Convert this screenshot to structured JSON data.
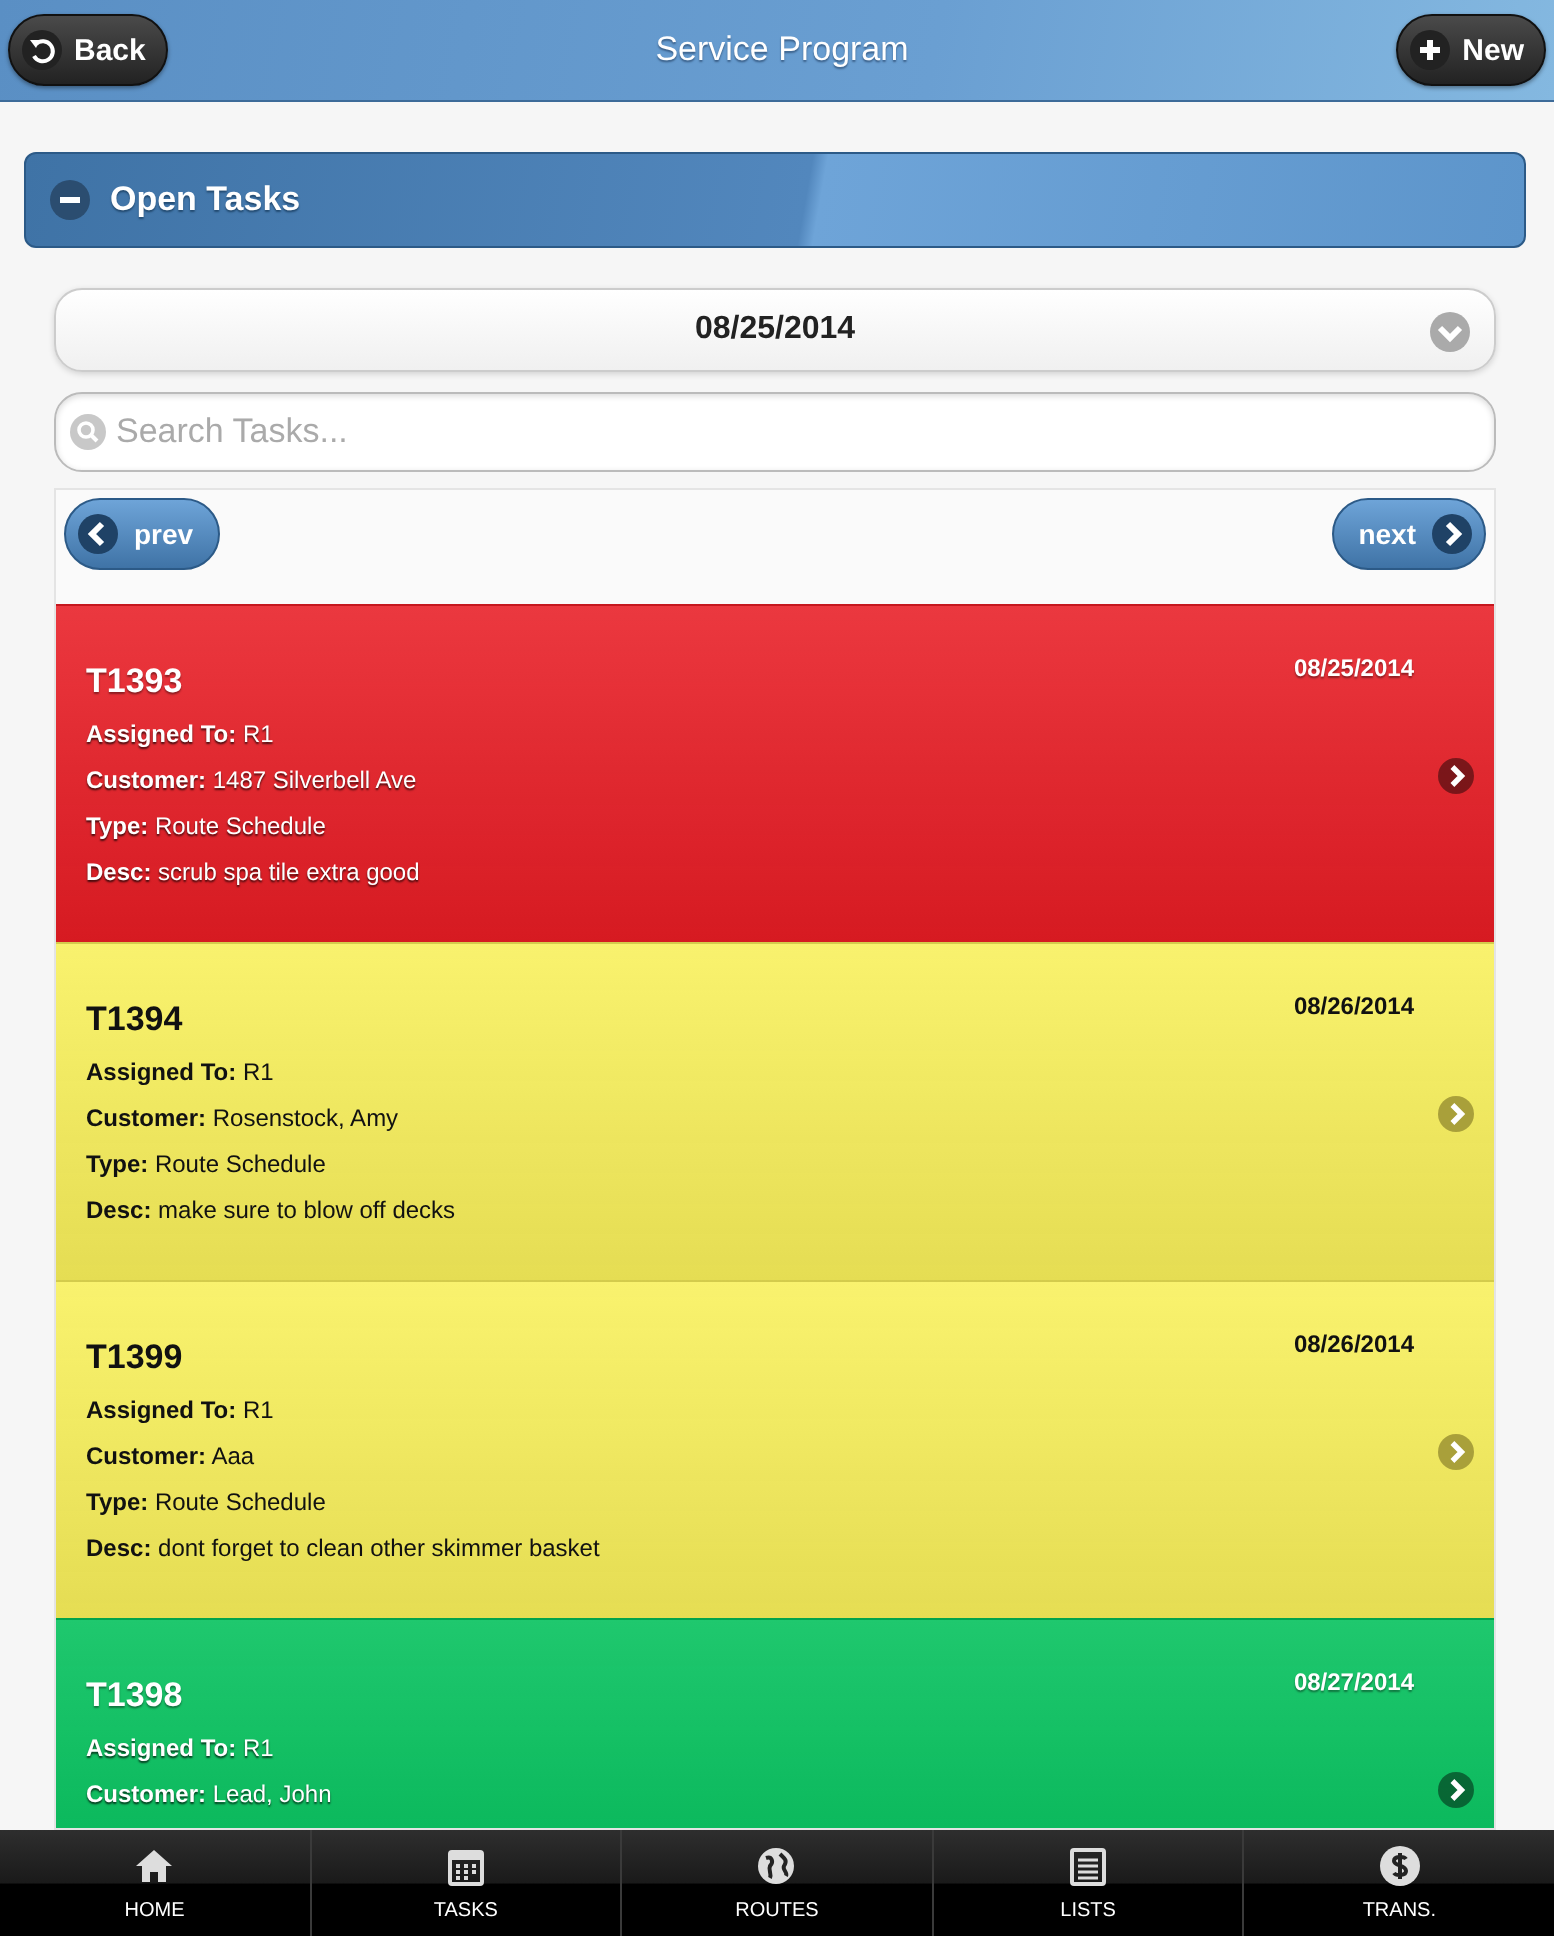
{
  "header": {
    "back": "Back",
    "title": "Service Program",
    "new": "New"
  },
  "section": {
    "title": "Open Tasks",
    "expanded": true
  },
  "date_select": {
    "value": "08/25/2014"
  },
  "search": {
    "placeholder": "Search Tasks..."
  },
  "pager": {
    "prev": "prev",
    "next": "next"
  },
  "tasks": [
    {
      "id": "T1393",
      "date": "08/25/2014",
      "color": "#e81c24",
      "fields": [
        {
          "label": "Assigned To:",
          "value": "R1"
        },
        {
          "label": "Customer:",
          "value": "1487 Silverbell Ave"
        },
        {
          "label": "Type:",
          "value": "Route Schedule"
        },
        {
          "label": "Desc:",
          "value": "scrub spa tile extra good"
        }
      ]
    },
    {
      "id": "T1394",
      "date": "08/26/2014",
      "color": "#f8f05a",
      "fields": [
        {
          "label": "Assigned To:",
          "value": "R1"
        },
        {
          "label": "Customer:",
          "value": "Rosenstock, Amy"
        },
        {
          "label": "Type:",
          "value": "Route Schedule"
        },
        {
          "label": "Desc:",
          "value": "make sure to blow off decks"
        }
      ]
    },
    {
      "id": "T1399",
      "date": "08/26/2014",
      "color": "#f8f05a",
      "fields": [
        {
          "label": "Assigned To:",
          "value": "R1"
        },
        {
          "label": "Customer:",
          "value": "Aaa"
        },
        {
          "label": "Type:",
          "value": "Route Schedule"
        },
        {
          "label": "Desc:",
          "value": "dont forget to clean other skimmer basket"
        }
      ]
    },
    {
      "id": "T1398",
      "date": "08/27/2014",
      "color": "#00c05a",
      "fields": [
        {
          "label": "Assigned To:",
          "value": "R1"
        },
        {
          "label": "Customer:",
          "value": "Lead, John"
        }
      ]
    }
  ],
  "nav": [
    {
      "kind": "home",
      "label": "HOME"
    },
    {
      "kind": "tasks",
      "label": "TASKS"
    },
    {
      "kind": "routes",
      "label": "ROUTES"
    },
    {
      "kind": "lists",
      "label": "LISTS"
    },
    {
      "kind": "money",
      "label": "TRANS."
    }
  ]
}
